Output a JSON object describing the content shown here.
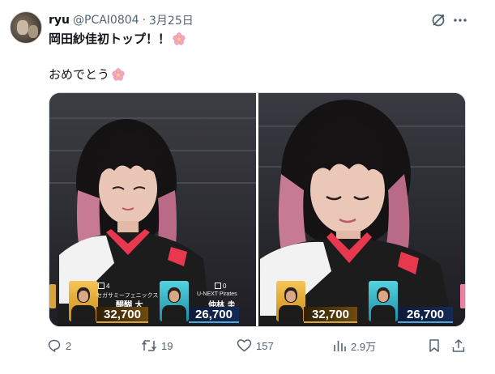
{
  "tweet": {
    "author_name": "ryu",
    "handle": "@PCAI0804",
    "separator": "·",
    "date": "3月25日",
    "line1": "岡田紗佳初トップ！！",
    "line2": "おめでとう",
    "emoji_icon": "cherry-blossom-icon"
  },
  "media": {
    "left": {
      "player1_score": "32,700",
      "player1_team": "セガサミーフェニックス",
      "player1_name": "醍醐 大",
      "player1_seat": "4",
      "player2_score": "26,700",
      "player2_team": "U-NEXT Pirates",
      "player2_name": "仲林 圭",
      "player2_seat": "0"
    },
    "right": {
      "player1_score": "32,700",
      "player2_score": "26,700"
    }
  },
  "actions": {
    "replies": "2",
    "retweets": "19",
    "likes": "157",
    "views": "2.9万"
  },
  "colors": {
    "text_primary": "#0f1419",
    "text_secondary": "#536471",
    "border": "#cfd9de",
    "accent_pink": "#f4a7c0"
  }
}
